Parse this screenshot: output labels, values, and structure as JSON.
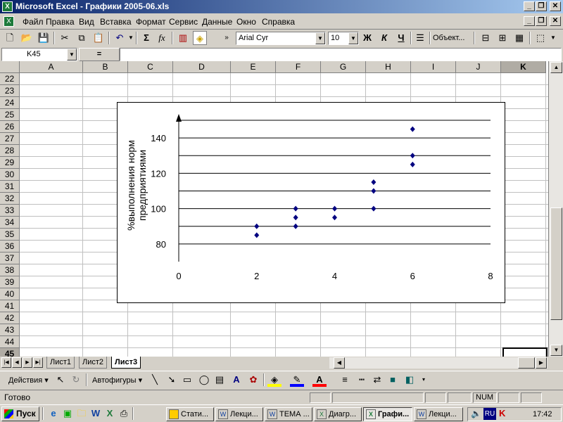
{
  "window": {
    "title": "Microsoft Excel - Графики 2005-06.xls"
  },
  "menu": [
    "Файл",
    "Правка",
    "Вид",
    "Вставка",
    "Формат",
    "Сервис",
    "Данные",
    "Окно",
    "Справка"
  ],
  "toolbar": {
    "font_name": "Arial Cyr",
    "font_size": "10",
    "bold": "Ж",
    "italic": "К",
    "underline": "Ч",
    "objects_label": "Объект...",
    "sum": "Σ",
    "fx": "fx"
  },
  "formula_bar": {
    "name_box": "K45",
    "equals": "=",
    "value": ""
  },
  "columns": [
    "A",
    "B",
    "C",
    "D",
    "E",
    "F",
    "G",
    "H",
    "I",
    "J",
    "K"
  ],
  "rows": [
    "22",
    "23",
    "24",
    "25",
    "26",
    "27",
    "28",
    "29",
    "30",
    "31",
    "32",
    "33",
    "34",
    "35",
    "36",
    "37",
    "38",
    "39",
    "40",
    "41",
    "42",
    "43",
    "44",
    "45"
  ],
  "sheet_tabs": [
    "Лист1",
    "Лист2",
    "Лист3"
  ],
  "active_sheet": "Лист3",
  "draw_toolbar": {
    "actions": "Действия",
    "autoshapes": "Автофигуры"
  },
  "status": {
    "ready": "Готово",
    "num": "NUM"
  },
  "taskbar": {
    "start": "Пуск",
    "tasks": [
      "Стати...",
      "Лекци...",
      "ТЕМА ...",
      "Диагр...",
      "Графи...",
      "Лекци..."
    ],
    "active_task": "Графи...",
    "lang": "RU",
    "time": "17:42"
  },
  "chart_data": {
    "type": "scatter",
    "title": "",
    "xlabel": "",
    "ylabel": "%выполнения норм предприятиями",
    "xlim": [
      0,
      8
    ],
    "ylim": [
      70,
      150
    ],
    "x_ticks": [
      0,
      2,
      4,
      6,
      8
    ],
    "y_ticks": [
      80,
      100,
      120,
      140
    ],
    "grid": "horizontal",
    "series": [
      {
        "color": "#000080",
        "x": [
          2,
          2,
          3,
          3,
          3,
          4,
          4,
          5,
          5,
          5,
          6,
          6,
          6
        ],
        "y": [
          90,
          85,
          100,
          95,
          90,
          100,
          95,
          115,
          110,
          100,
          145,
          130,
          125
        ]
      }
    ]
  }
}
